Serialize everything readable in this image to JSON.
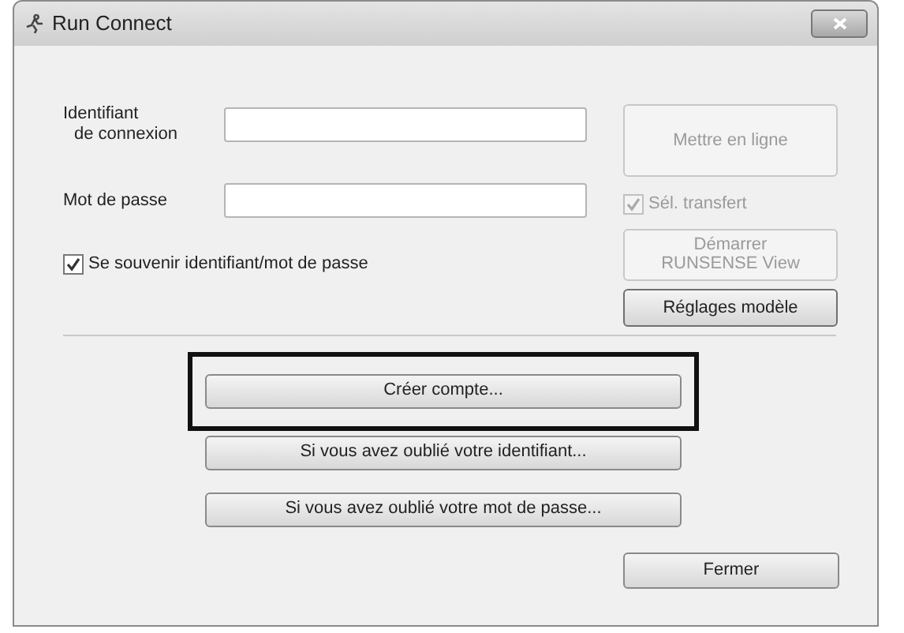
{
  "window": {
    "title": "Run Connect"
  },
  "fields": [
    {
      "label_lines": [
        "Identifiant",
        "de connexion"
      ]
    },
    {
      "label_lines": [
        "Mot de passe"
      ]
    }
  ],
  "remember": {
    "label": "Se souvenir identifiant/mot de passe",
    "checked": true
  },
  "side_controls": [
    {
      "kind": "button",
      "label_lines": [
        "Mettre en ligne"
      ],
      "disabled": true
    },
    {
      "kind": "checkbox",
      "label": "Sél. transfert",
      "checked": true,
      "disabled": true
    },
    {
      "kind": "button",
      "label_lines": [
        "Démarrer",
        "RUNSENSE View"
      ],
      "disabled": true
    },
    {
      "kind": "button",
      "label_lines": [
        "Réglages modèle"
      ],
      "disabled": false
    }
  ],
  "account_buttons": [
    {
      "label": "Créer compte...",
      "highlighted": true
    },
    {
      "label": "Si vous avez oublié votre identifiant...",
      "highlighted": false
    },
    {
      "label": "Si vous avez oublié votre mot de passe...",
      "highlighted": false
    }
  ],
  "close_button": {
    "label": "Fermer"
  }
}
